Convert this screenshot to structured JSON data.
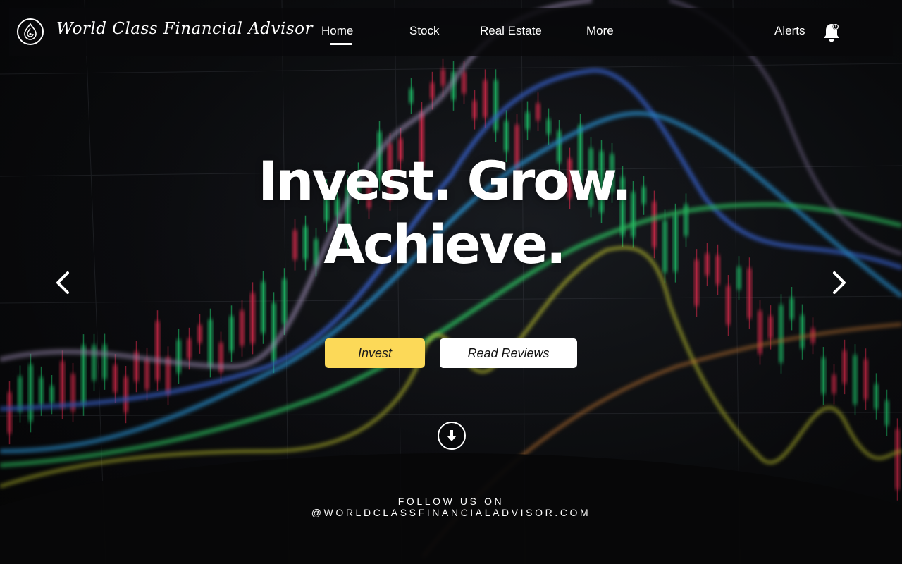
{
  "brand": {
    "name": "World Class Financial Advisor",
    "logo_icon": "droplet-logo-icon"
  },
  "nav": {
    "items": [
      {
        "label": "Home",
        "active": true
      },
      {
        "label": "Stock"
      },
      {
        "label": "Real Estate"
      },
      {
        "label": "More"
      }
    ],
    "alerts_label": "Alerts",
    "alerts_icon": "bell-icon"
  },
  "hero": {
    "headline_line1": "Invest. Grow.",
    "headline_line2": "Achieve.",
    "background": "stock-market-candlestick-chart",
    "prev_icon": "chevron-left-icon",
    "next_icon": "chevron-right-icon"
  },
  "buttons": {
    "invest_label": "Invest",
    "reviews_label": "Read Reviews",
    "invest_color": "#fcd958",
    "reviews_color": "#ffffff"
  },
  "scroll_icon": "arrow-down-circle-icon",
  "footer": {
    "follow_line1": "FOLLOW US ON",
    "follow_line2": "@WORLDCLASSFINANCIALADVISOR.COM"
  }
}
